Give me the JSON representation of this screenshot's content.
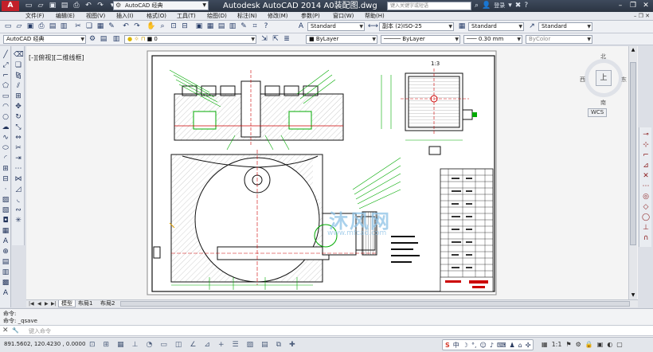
{
  "titlebar": {
    "logo": "A",
    "workspace": "AutoCAD 经典",
    "title": "Autodesk AutoCAD 2014    A0装配图.dwg",
    "search_placeholder": "键入关键字或短语",
    "login": "登录"
  },
  "menu": {
    "items": [
      "文件(F)",
      "编辑(E)",
      "视图(V)",
      "插入(I)",
      "格式(O)",
      "工具(T)",
      "绘图(D)",
      "标注(N)",
      "修改(M)",
      "参数(P)",
      "窗口(W)",
      "帮助(H)"
    ]
  },
  "toolbar1": {
    "text_style": "Standard",
    "dim_style": "副本 (2)ISO-25",
    "table_style": "Standard",
    "mleader_style": "Standard"
  },
  "toolbar2": {
    "workspace": "AutoCAD 经典",
    "layer": "0",
    "color": "ByLayer",
    "linetype": "ByLayer",
    "lineweight": "0.30 mm",
    "plotstyle": "ByColor"
  },
  "viewport": {
    "label": "[-][俯视][二维线框]",
    "scale_text": "1:3"
  },
  "viewcube": {
    "north": "北",
    "south": "南",
    "west": "西",
    "east": "东",
    "face": "上",
    "wcs": "WCS"
  },
  "tabs": [
    "模型",
    "布局1",
    "布局2"
  ],
  "command": {
    "history": [
      "命令:",
      "命令:  _qsave"
    ],
    "placeholder": "键入命令"
  },
  "status": {
    "coords": "891.5602,  120.4230 , 0.0000",
    "ime_lang": "中",
    "zoom": "1:1"
  },
  "watermark": {
    "text": "沐风网",
    "url": "www.mfcad.com"
  }
}
